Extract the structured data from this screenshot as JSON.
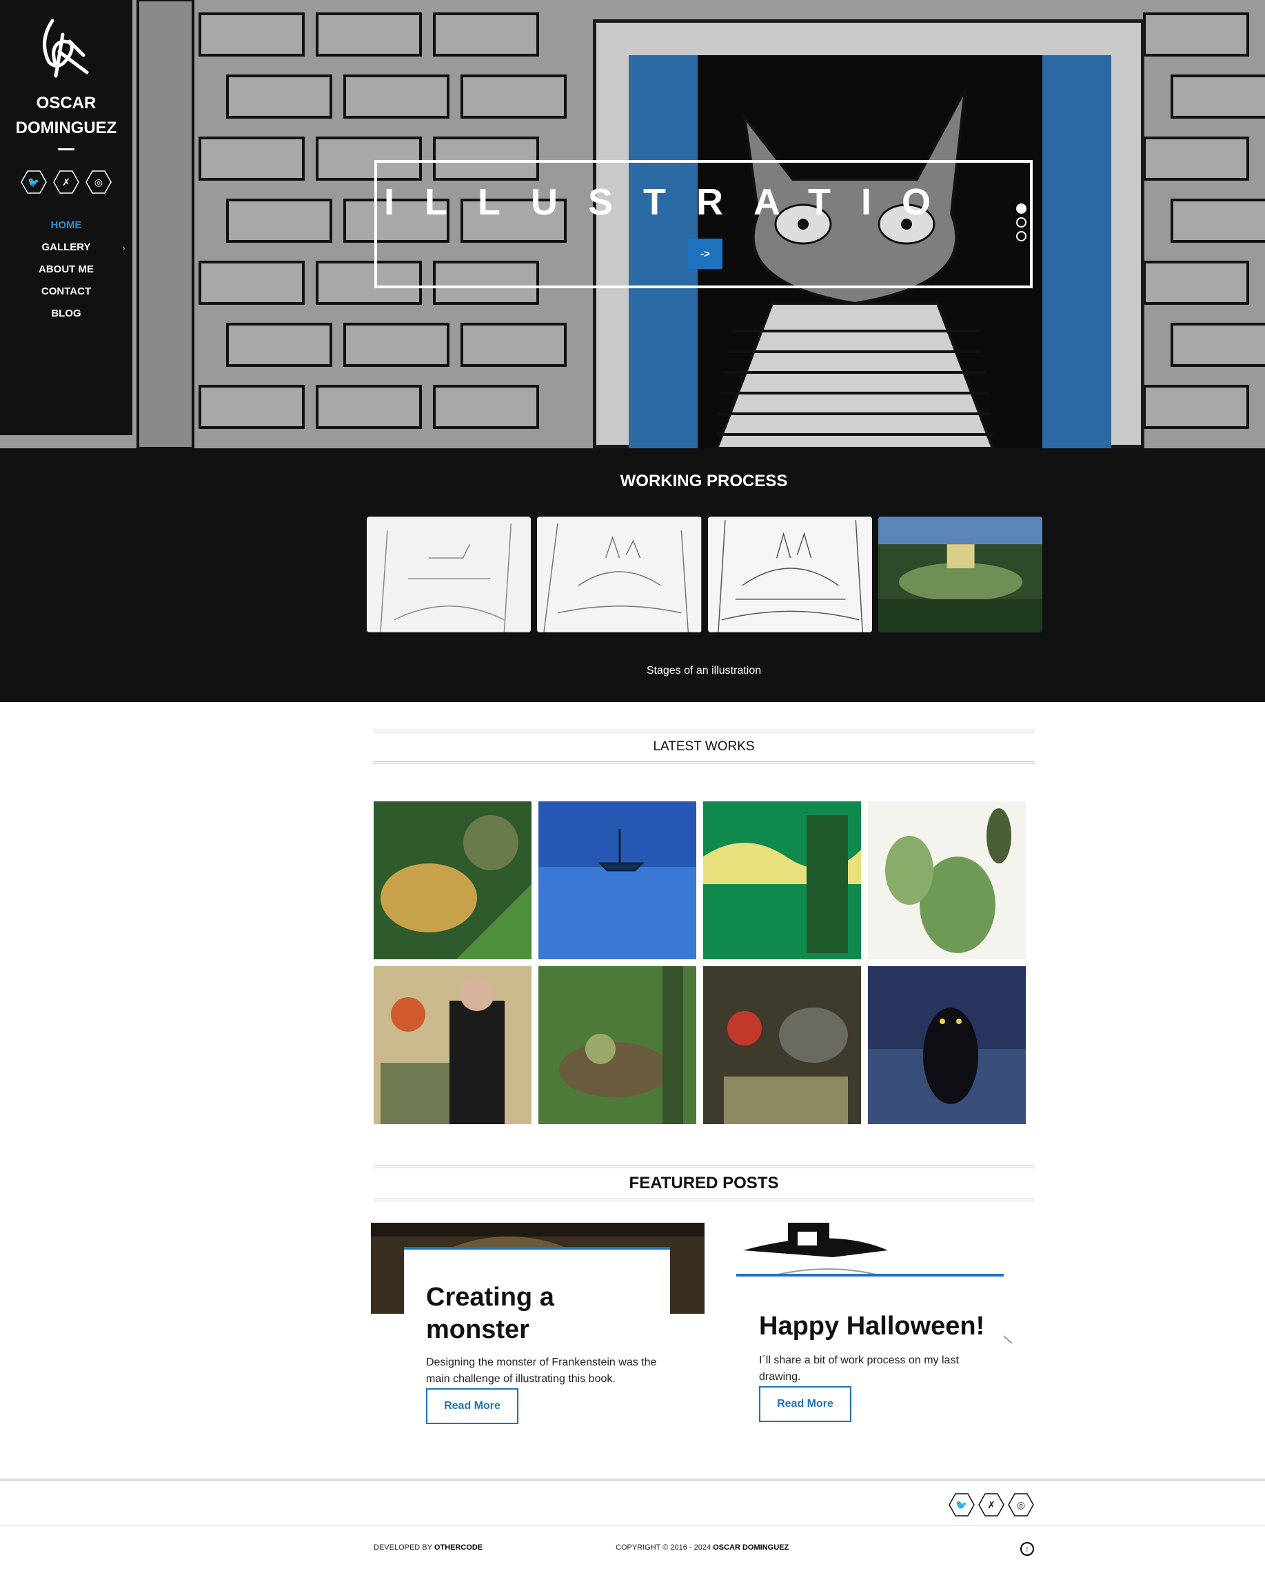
{
  "brand": {
    "name": "OSCAR DOMINGUEZ"
  },
  "social": [
    {
      "name": "twitter",
      "icon": "twitter-icon",
      "glyph": "🐦"
    },
    {
      "name": "deviantart",
      "icon": "deviantart-icon",
      "glyph": "✗"
    },
    {
      "name": "instagram",
      "icon": "instagram-icon",
      "glyph": "◎"
    }
  ],
  "nav": {
    "items": [
      {
        "label": "HOME",
        "active": true
      },
      {
        "label": "GALLERY",
        "has_submenu": true
      },
      {
        "label": "ABOUT ME"
      },
      {
        "label": "CONTACT"
      },
      {
        "label": "BLOG"
      }
    ]
  },
  "hero": {
    "title": "ILLUSTRATIO",
    "button_label": "->",
    "slides": 3,
    "active_slide": 1
  },
  "process": {
    "title": "WORKING PROCESS",
    "caption": "Stages of an illustration"
  },
  "latest": {
    "title": "LATEST WORKS"
  },
  "featured": {
    "title": "FEATURED POSTS",
    "posts": [
      {
        "title": "Creating a monster",
        "excerpt": "Designing the monster of Frankenstein was the main challenge of illustrating this book.",
        "button": "Read More"
      },
      {
        "title": "Happy Halloween!",
        "excerpt": "I´ll share a bit of work process on my last drawing.",
        "button": "Read More"
      }
    ]
  },
  "footer": {
    "developed_prefix": "DEVELOPED BY ",
    "developed_by": "OTHERCODE",
    "copyright_prefix": "COPYRIGHT © 2016 - 2024 ",
    "copyright_owner": "OSCAR DOMINGUEZ",
    "to_top_glyph": "↑"
  },
  "colors": {
    "accent": "#1e73be",
    "nav_active": "#2e8fd6",
    "dark": "#111111"
  }
}
